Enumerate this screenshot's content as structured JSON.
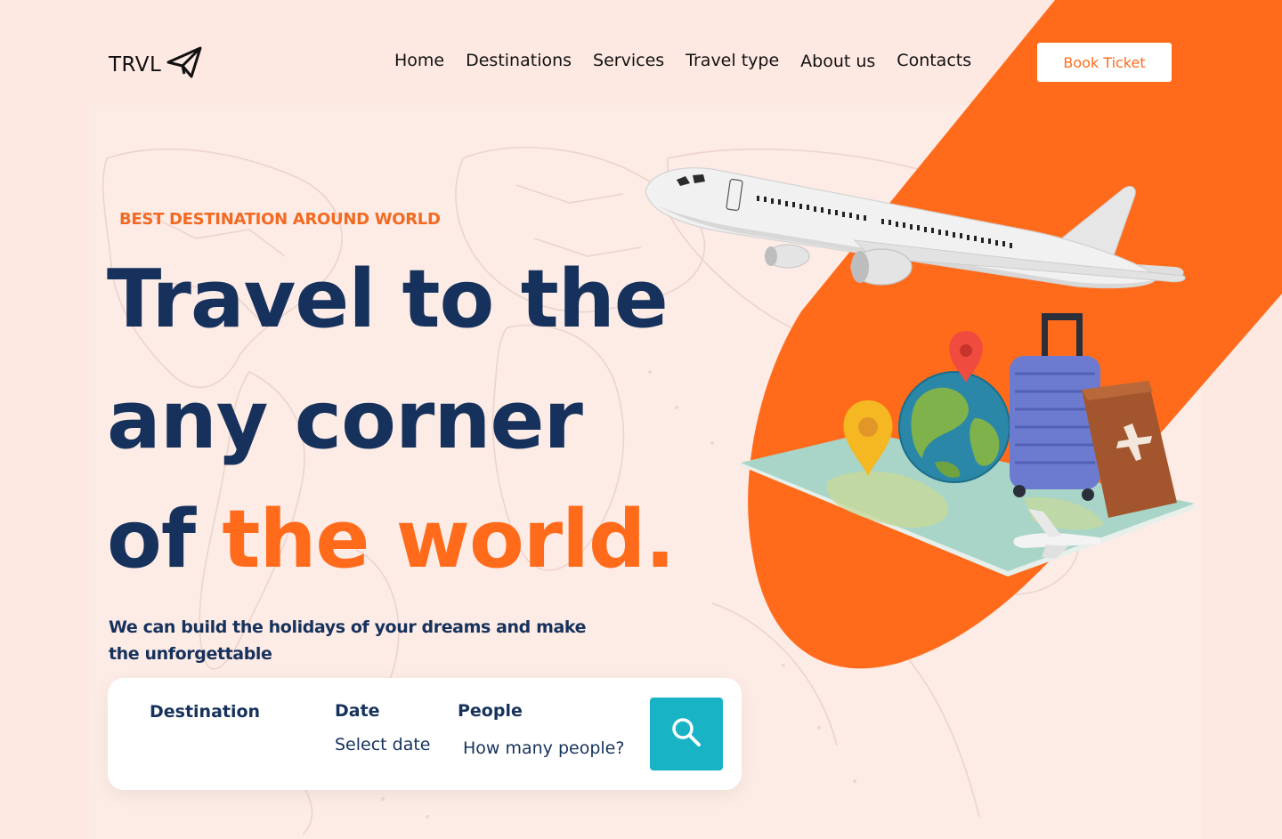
{
  "brand": {
    "name": "TRVL",
    "icon": "paper-plane-icon"
  },
  "nav": {
    "items": [
      "Home",
      "Destinations",
      "Services",
      "Travel type",
      "About us",
      "Contacts"
    ],
    "cta": "Book Ticket"
  },
  "hero": {
    "tagline": "BEST DESTINATION AROUND WORLD",
    "line1": "Travel to the",
    "line2": "any corner",
    "line3_prefix": "of ",
    "line3_accent": "the world.",
    "subtext": "We  can build the holidays of your dreams and make the unforgettable"
  },
  "search": {
    "destination_label": "Destination",
    "date_label": "Date",
    "date_placeholder": "Select date",
    "people_label": "People",
    "people_placeholder": "How many people?",
    "button_icon": "search-icon"
  },
  "colors": {
    "background": "#fde8e2",
    "accent": "#ff6b1b",
    "navy": "#16325c",
    "teal": "#19b3c6"
  }
}
